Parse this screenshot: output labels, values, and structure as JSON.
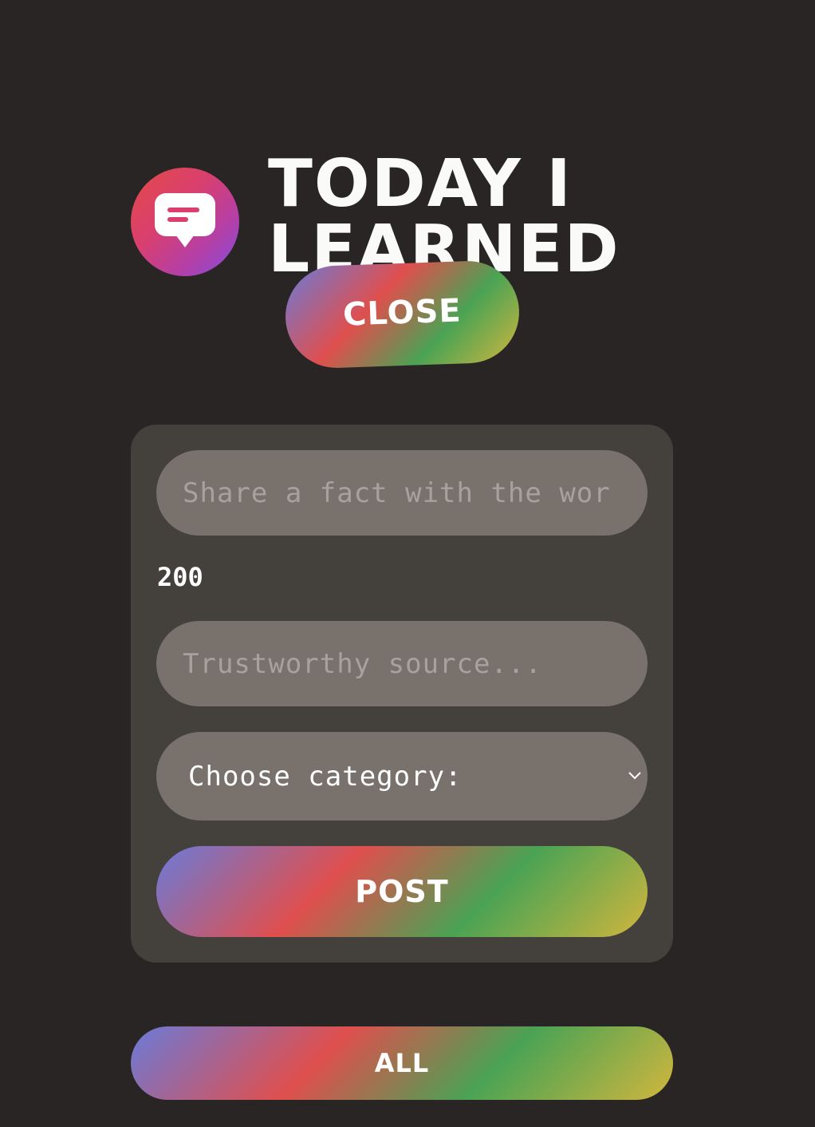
{
  "header": {
    "title": "TODAY I LEARNED",
    "logo_icon": "chat-bubble-icon"
  },
  "toolbar": {
    "close_label": "CLOSE"
  },
  "form": {
    "fact_placeholder": "Share a fact with the wor",
    "char_count": "200",
    "source_placeholder": "Trustworthy source...",
    "category_selected": "Choose category:",
    "post_label": "POST"
  },
  "filters": {
    "all_label": "ALL"
  },
  "colors": {
    "background": "#292524",
    "panel": "#44403c",
    "input": "#78716c",
    "text": "#fafaf9",
    "gradient_start": "#6a7bd9",
    "gradient_red": "#df4f4e",
    "gradient_green": "#4aa354",
    "gradient_end": "#d1b63e"
  }
}
